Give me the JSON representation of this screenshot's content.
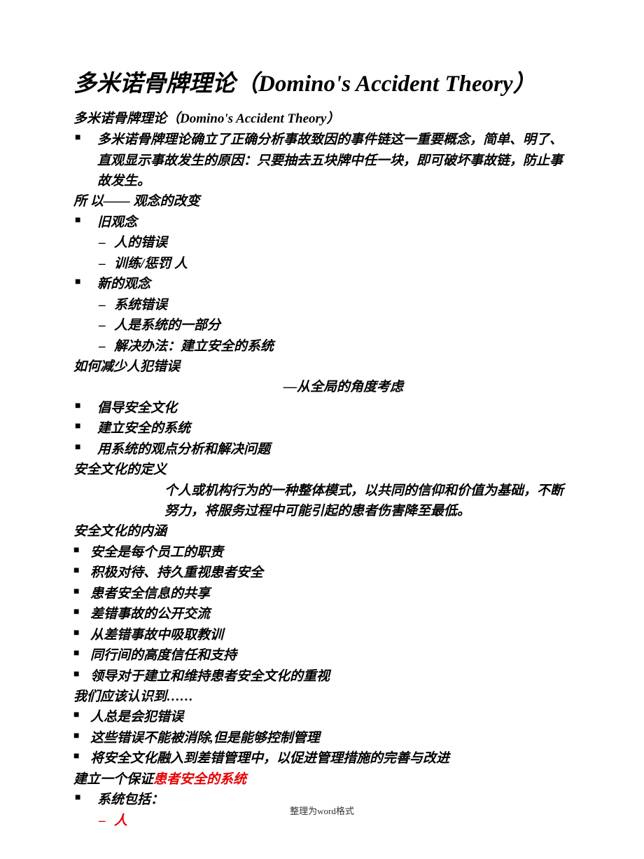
{
  "title": "多米诺骨牌理论（Domino's Accident Theory）",
  "subtitle": "多米诺骨牌理论（Domino's Accident Theory）",
  "intro": "多米诺骨牌理论确立了正确分析事故致因的事件链这一重要概念，简单、明了、直观显示事故发生的原因：只要抽去五块牌中任一块，即可破坏事故链，防止事故发生。",
  "concept_change_heading": "所 以—— 观念的改变",
  "old_concept_label": "旧观念",
  "old_concept_items": [
    "人的错误",
    "训练/惩罚 人"
  ],
  "new_concept_label": "新的观念",
  "new_concept_items": [
    "系统错误",
    "人是系统的一部分",
    "解决办法：建立安全的系统"
  ],
  "reduce_heading": "如何减少人犯错误",
  "reduce_subtitle": "—从全局的角度考虑",
  "reduce_items": [
    "倡导安全文化",
    "建立安全的系统",
    "用系统的观点分析和解决问题"
  ],
  "safety_def_heading": "安全文化的定义",
  "safety_def_body": "个人或机构行为的一种整体模式，以共同的信仰和价值为基础，不断努力，将服务过程中可能引起的患者伤害降至最低。",
  "safety_content_heading": "安全文化的内涵",
  "safety_content_items": [
    "安全是每个员工的职责",
    "积极对待、持久重视患者安全",
    "患者安全信息的共享",
    "差错事故的公开交流",
    "从差错事故中吸取教训",
    "同行间的高度信任和支持",
    "领导对于建立和维持患者安全文化的重视"
  ],
  "realize_heading": "我们应该认识到……",
  "realize_items": [
    "人总是会犯错误",
    "这些错误不能被消除,但是能够控制管理",
    "将安全文化融入到差错管理中，以促进管理措施的完善与改进"
  ],
  "build_system_prefix": "建立一个保证",
  "build_system_highlight": "患者安全的系统",
  "system_includes_label": "系统包括：",
  "system_includes_items": [
    "人"
  ],
  "footer": "整理为word格式"
}
